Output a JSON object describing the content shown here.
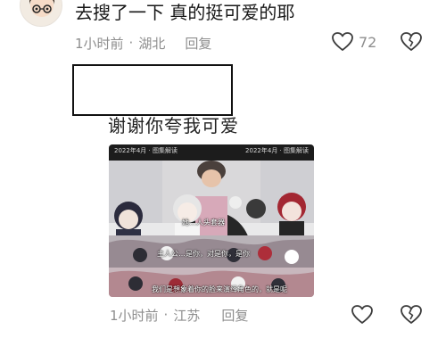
{
  "comment_1": {
    "text": "去搜了一下 真的挺可爱的耶",
    "time": "1小时前",
    "location": "湖北",
    "separator": "·",
    "reply_label": "回复",
    "like_count": "72"
  },
  "comment_2": {
    "text": "谢谢你夸我可爱",
    "time": "1小时前",
    "location": "江苏",
    "separator": "·",
    "reply_label": "回复",
    "image": {
      "subtitle_1": "她…人头套器",
      "subtitle_2": "主人公…是你，对是你，是你",
      "subtitle_3": "我们是想象着你的脸来演绎角色的，就是呢",
      "banner_left": "2022年4月 · 图集解读",
      "banner_right": "2022年4月 · 图集解读"
    }
  },
  "icons": {
    "heart": "heart-outline",
    "broken_heart": "broken-heart-outline"
  },
  "colors": {
    "meta_text": "#8e8e8e",
    "main_text": "#171717",
    "box_border": "#111111"
  }
}
